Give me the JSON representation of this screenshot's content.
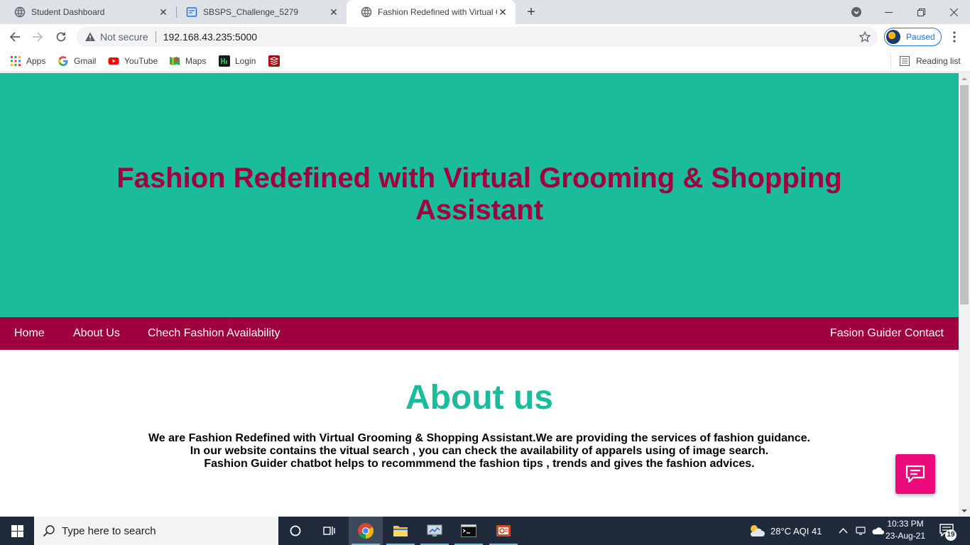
{
  "browser": {
    "tabs": [
      {
        "title": "Student Dashboard",
        "active": false
      },
      {
        "title": "SBSPS_Challenge_5279",
        "active": false
      },
      {
        "title": "Fashion Redefined with Virtual Gr",
        "active": true
      }
    ],
    "security_label": "Not secure",
    "url": "192.168.43.235:5000",
    "profile_label": "Paused",
    "bookmarks": [
      "Apps",
      "Gmail",
      "YouTube",
      "Maps",
      "Login"
    ],
    "reading_list": "Reading list"
  },
  "page": {
    "hero_title": "Fashion Redefined with Virtual Grooming & Shopping Assistant",
    "nav": {
      "home": "Home",
      "about": "About Us",
      "check": "Chech Fashion Availability",
      "contact": "Fasion Guider Contact"
    },
    "about_title": "About us",
    "about_lines": [
      "We are Fashion Redefined with Virtual Grooming & Shopping Assistant.We are providing the services of fashion guidance.",
      "In our website contains the vitual search , you can check the availability of apparels using of image search.",
      "Fashion Guider chatbot helps to recommmend the fashion tips , trends and gives the fashion advices."
    ],
    "chat_icon": "chat-icon"
  },
  "taskbar": {
    "search_placeholder": "Type here to search",
    "weather": "28°C  AQI 41",
    "time": "10:33 PM",
    "date": "23-Aug-21",
    "notification_count": "19"
  },
  "colors": {
    "hero_bg": "#1abc9c",
    "accent": "#a0003d",
    "chat_fab": "#ea0a7b"
  }
}
